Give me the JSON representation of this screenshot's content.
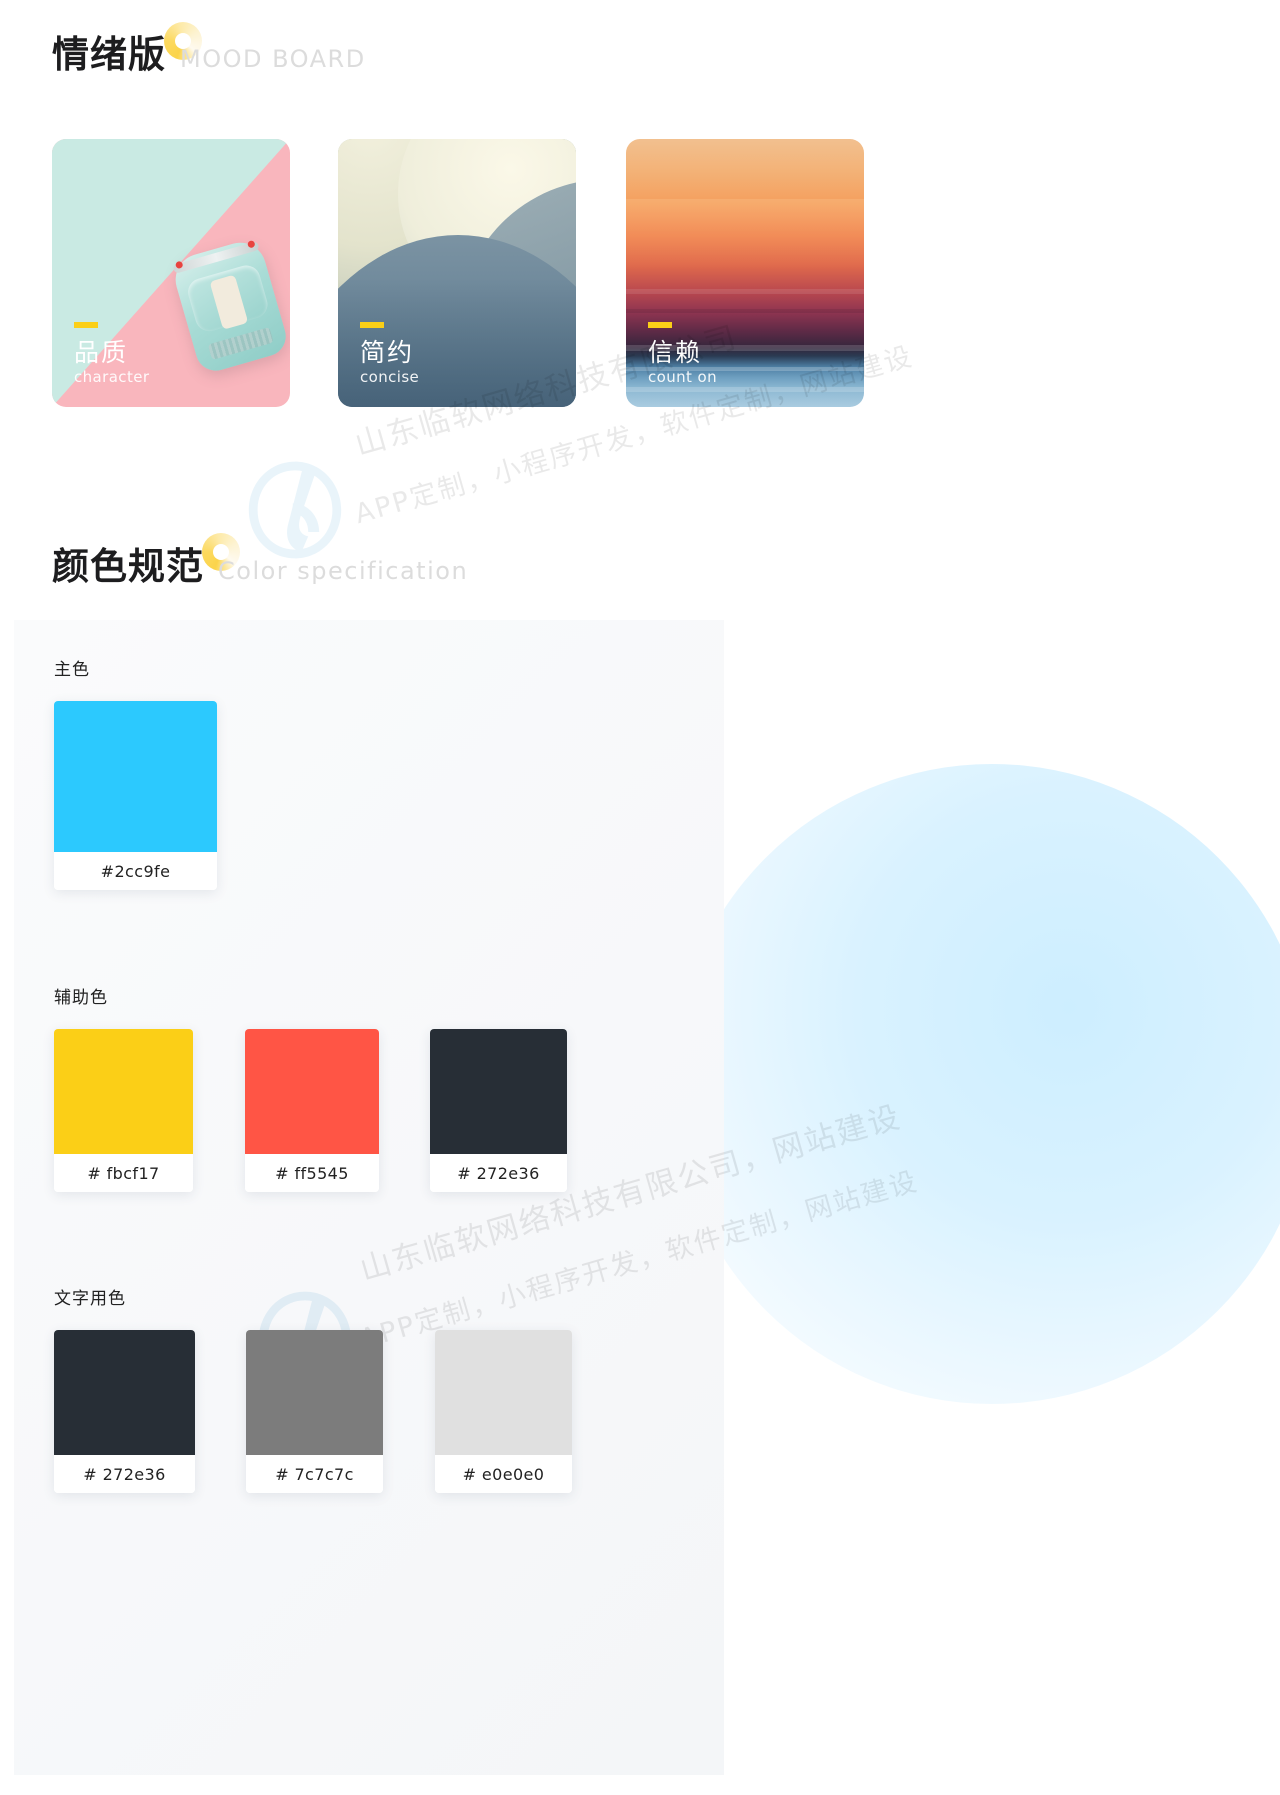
{
  "sections": [
    {
      "id": "mood-board",
      "title_cn": "情绪版",
      "title_en": "MOOD BOARD"
    },
    {
      "id": "color-specification",
      "title_cn": "颜色规范",
      "title_en": "Color specification"
    }
  ],
  "mood_cards": [
    {
      "label_cn": "品质",
      "label_en": "character",
      "art": "pastel-toy-car"
    },
    {
      "label_cn": "简约",
      "label_en": "concise",
      "art": "abstract-curve"
    },
    {
      "label_cn": "信赖",
      "label_en": "count on",
      "art": "sunset-sea"
    }
  ],
  "color_groups": [
    {
      "label": "主色",
      "swatches": [
        {
          "hex_label": "#2cc9fe",
          "color": "#2cc9fe"
        }
      ]
    },
    {
      "label": "辅助色",
      "swatches": [
        {
          "hex_label": "# fbcf17",
          "color": "#fbcf17"
        },
        {
          "hex_label": "# ff5545",
          "color": "#ff5545"
        },
        {
          "hex_label": "# 272e36",
          "color": "#272e36"
        }
      ]
    },
    {
      "label": "文字用色",
      "swatches": [
        {
          "hex_label": "# 272e36",
          "color": "#272e36"
        },
        {
          "hex_label": "# 7c7c7c",
          "color": "#7c7c7c"
        },
        {
          "hex_label": "# e0e0e0",
          "color": "#e0e0e0"
        }
      ]
    }
  ],
  "accents": {
    "caption_dash": "#fbcf17",
    "heading_dot": "#fbd44a",
    "background_circle": "#d9f2ff"
  },
  "watermarks": [
    {
      "text": "山东临软网络科技有限公司"
    },
    {
      "text": "APP定制，小程序开发，软件定制，网站建设"
    },
    {
      "text": "山东临软网络科技有限公司，网站建设"
    },
    {
      "text": "APP定制，小程序开发，软件定制，网站建设"
    }
  ]
}
